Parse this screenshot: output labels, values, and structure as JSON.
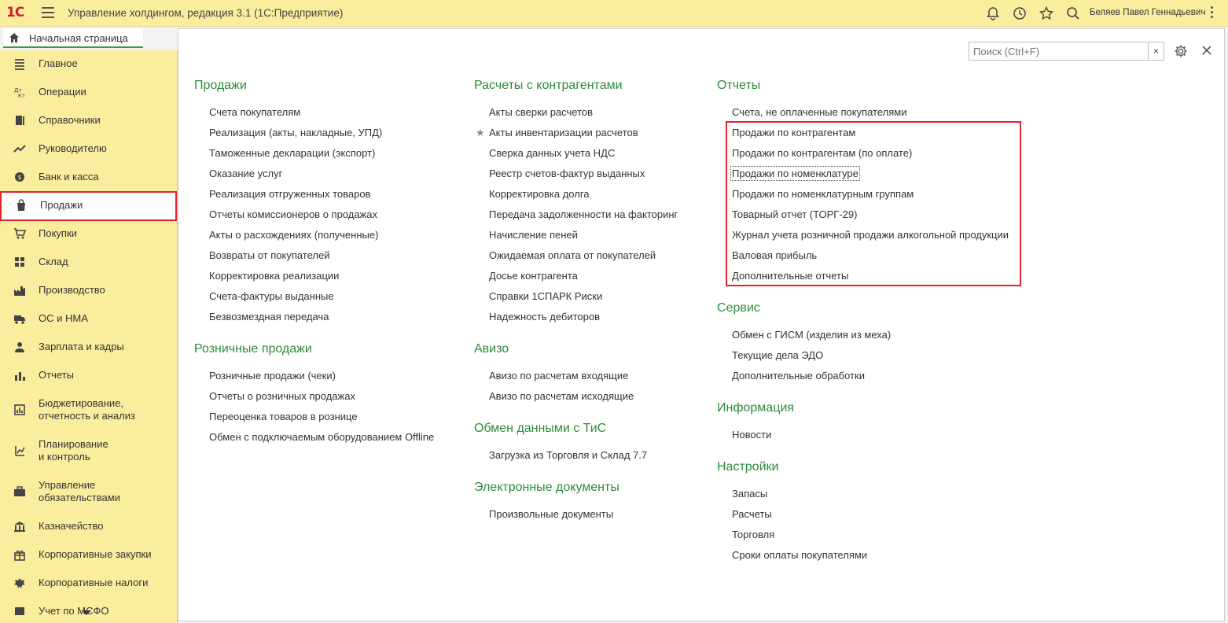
{
  "app": {
    "logo": "1С",
    "title": "Управление холдингом, редакция 3.1  (1С:Предприятие)",
    "user": "Беляев Павел Геннадьевич"
  },
  "tabs": [
    {
      "label": "Начальная страница"
    }
  ],
  "sidebar": {
    "items": [
      {
        "label": "Главное",
        "icon": "menu-lines-icon"
      },
      {
        "label": "Операции",
        "icon": "operations-icon"
      },
      {
        "label": "Справочники",
        "icon": "books-icon"
      },
      {
        "label": "Руководителю",
        "icon": "trend-icon"
      },
      {
        "label": "Банк и касса",
        "icon": "coin-icon"
      },
      {
        "label": "Продажи",
        "icon": "shopping-bag-icon"
      },
      {
        "label": "Покупки",
        "icon": "cart-icon"
      },
      {
        "label": "Склад",
        "icon": "warehouse-icon"
      },
      {
        "label": "Производство",
        "icon": "factory-icon"
      },
      {
        "label": "ОС и НМА",
        "icon": "truck-icon"
      },
      {
        "label": "Зарплата и кадры",
        "icon": "person-icon"
      },
      {
        "label": "Отчеты",
        "icon": "bar-chart-icon"
      },
      {
        "label": "Бюджетирование,\nотчетность и анализ",
        "icon": "budget-icon"
      },
      {
        "label": "Планирование\nи контроль",
        "icon": "planning-icon"
      },
      {
        "label": "Управление\nобязательствами",
        "icon": "briefcase-icon"
      },
      {
        "label": "Казначейство",
        "icon": "treasury-icon"
      },
      {
        "label": "Корпоративные закупки",
        "icon": "gift-icon"
      },
      {
        "label": "Корпоративные налоги",
        "icon": "emblem-icon"
      },
      {
        "label": "Учет по МСФО",
        "icon": "msfo-icon"
      }
    ],
    "active_index": 5
  },
  "search": {
    "placeholder": "Поиск (Ctrl+F)",
    "clear": "×"
  },
  "columns": [
    {
      "sections": [
        {
          "title": "Продажи",
          "items": [
            "Счета покупателям",
            "Реализация (акты, накладные, УПД)",
            "Таможенные декларации (экспорт)",
            "Оказание услуг",
            "Реализация отгруженных товаров",
            "Отчеты комиссионеров о продажах",
            "Акты о расхождениях (полученные)",
            "Возвраты от покупателей",
            "Корректировка реализации",
            "Счета-фактуры выданные",
            "Безвозмездная передача"
          ]
        },
        {
          "title": "Розничные продажи",
          "items": [
            "Розничные продажи (чеки)",
            "Отчеты о розничных продажах",
            "Переоценка товаров в рознице",
            "Обмен с подключаемым оборудованием Offline"
          ]
        }
      ]
    },
    {
      "sections": [
        {
          "title": "Расчеты с контрагентами",
          "items": [
            "Акты сверки расчетов",
            "Акты инвентаризации расчетов",
            "Сверка данных учета НДС",
            "Реестр счетов-фактур выданных",
            "Корректировка долга",
            "Передача задолженности на факторинг",
            "Начисление пеней",
            "Ожидаемая оплата от покупателей",
            "Досье контрагента",
            "Справки 1СПАРК Риски",
            "Надежность дебиторов"
          ]
        },
        {
          "title": "Авизо",
          "items": [
            "Авизо по расчетам входящие",
            "Авизо по расчетам исходящие"
          ]
        },
        {
          "title": "Обмен данными с ТиС",
          "items": [
            "Загрузка из Торговля и Склад 7.7"
          ]
        },
        {
          "title": "Электронные документы",
          "items": [
            "Произвольные документы"
          ]
        }
      ]
    },
    {
      "sections": [
        {
          "title": "Отчеты",
          "items": [
            "Счета, не оплаченные покупателями",
            "Продажи по контрагентам",
            "Продажи по контрагентам (по оплате)",
            "Продажи по номенклатуре",
            "Продажи по номенклатурным группам",
            "Товарный отчет (ТОРГ-29)",
            "Журнал учета розничной продажи алкогольной продукции",
            "Валовая прибыль",
            "Дополнительные отчеты"
          ]
        },
        {
          "title": "Сервис",
          "items": [
            "Обмен с ГИСМ (изделия из меха)",
            "Текущие дела ЭДО",
            "Дополнительные обработки"
          ]
        },
        {
          "title": "Информация",
          "items": [
            "Новости"
          ]
        },
        {
          "title": "Настройки",
          "items": [
            "Запасы",
            "Расчеты",
            "Торговля",
            "Сроки оплаты покупателями"
          ]
        }
      ]
    }
  ],
  "colors": {
    "accent_green": "#2e8b3a",
    "sidebar_bg": "#fbed9e",
    "highlight_red": "#e0242b"
  }
}
